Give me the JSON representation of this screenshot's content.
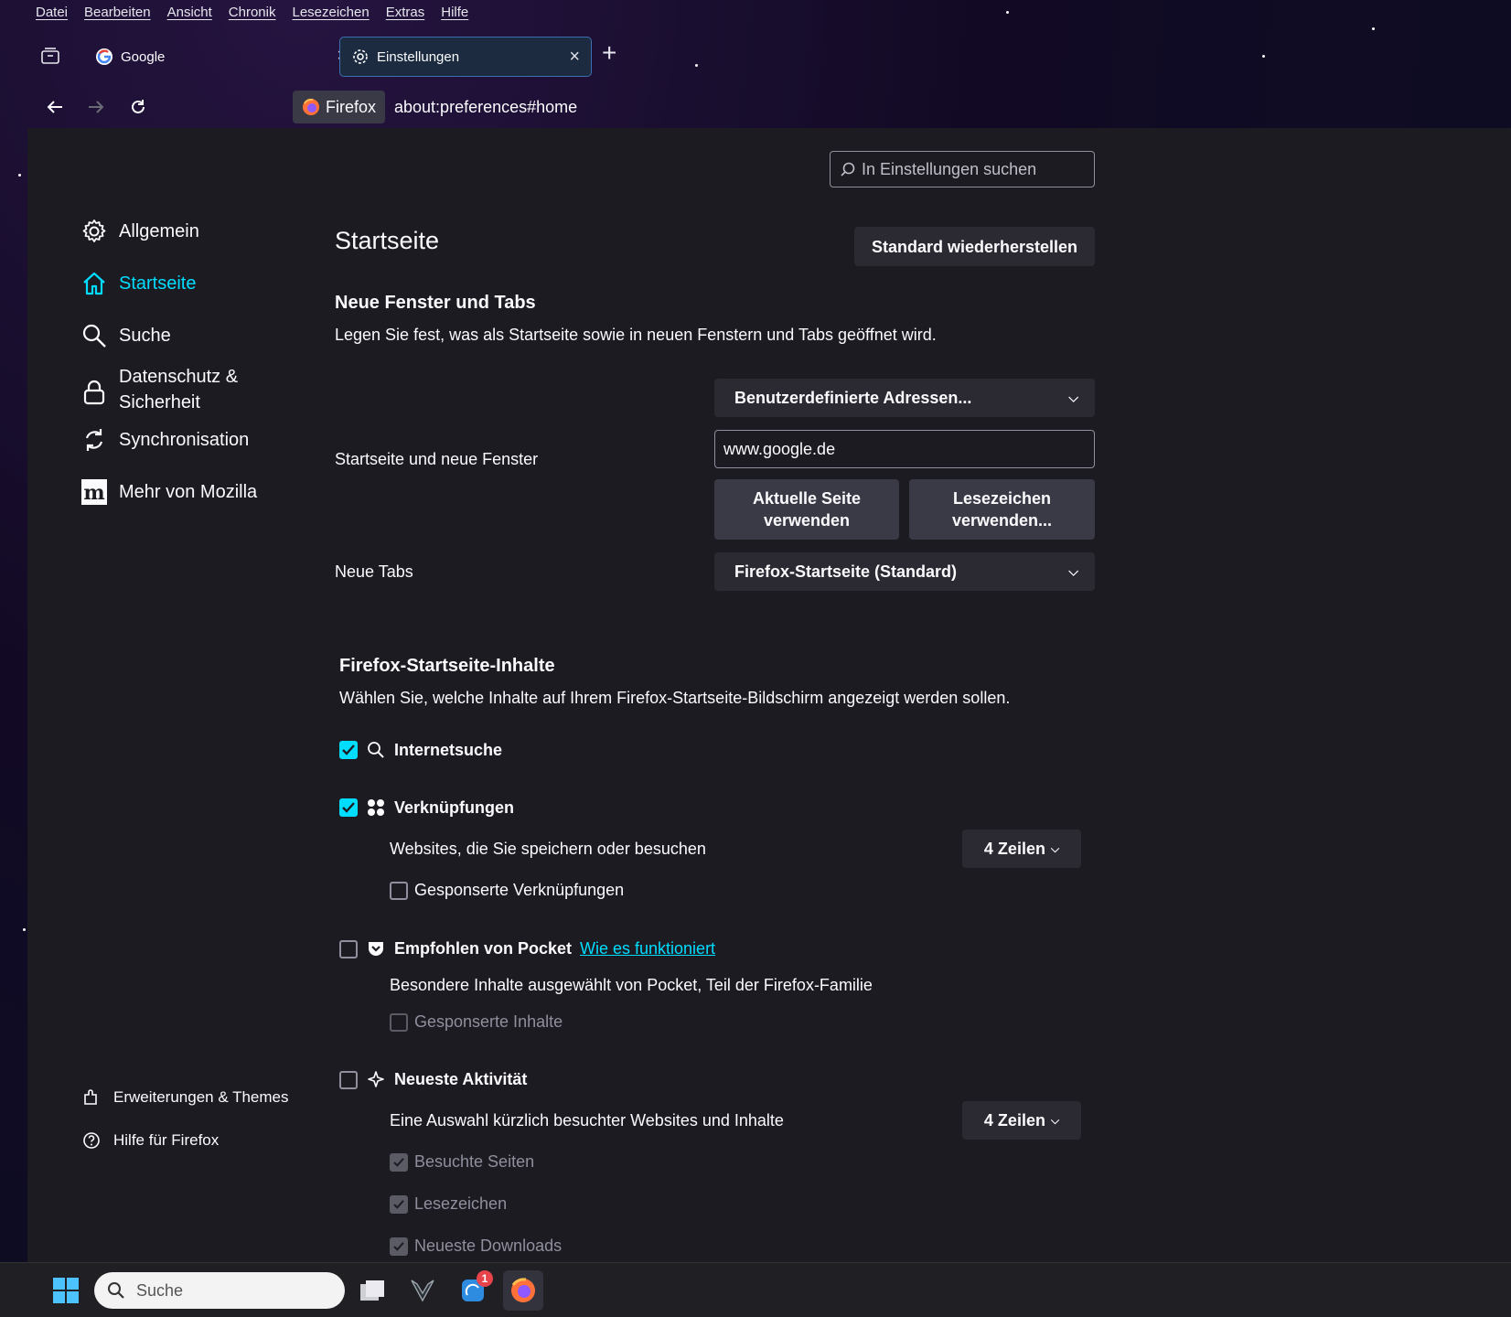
{
  "menubar": [
    "Datei",
    "Bearbeiten",
    "Ansicht",
    "Chronik",
    "Lesezeichen",
    "Extras",
    "Hilfe"
  ],
  "tabs": [
    {
      "label": "Google",
      "icon": "google-icon"
    },
    {
      "label": "Einstellungen",
      "icon": "gear-icon"
    }
  ],
  "urlbar": {
    "identity": "Firefox",
    "url": "about:preferences#home"
  },
  "search": {
    "placeholder": "In Einstellungen suchen"
  },
  "sidebar": {
    "items": [
      {
        "label": "Allgemein",
        "icon": "gear-icon"
      },
      {
        "label": "Startseite",
        "icon": "home-icon",
        "selected": true
      },
      {
        "label": "Suche",
        "icon": "search-icon"
      },
      {
        "label": "Datenschutz &",
        "label2": "Sicherheit",
        "icon": "lock-icon"
      },
      {
        "label": "Synchronisation",
        "icon": "sync-icon"
      },
      {
        "label": "Mehr von Mozilla",
        "icon": "mozilla-icon"
      }
    ],
    "footer": [
      {
        "label": "Erweiterungen & Themes",
        "icon": "puzzle-icon"
      },
      {
        "label": "Hilfe für Firefox",
        "icon": "help-icon"
      }
    ]
  },
  "main": {
    "title": "Startseite",
    "restore_button": "Standard wiederherstellen",
    "section1": {
      "heading": "Neue Fenster und Tabs",
      "description": "Legen Sie fest, was als Startseite sowie in neuen Fenstern und Tabs geöffnet wird.",
      "homepage_label": "Startseite und neue Fenster",
      "homepage_select": "Benutzerdefinierte Adressen...",
      "homepage_url": "www.google.de",
      "use_current_line1": "Aktuelle Seite",
      "use_current_line2": "verwenden",
      "use_bookmark_line1": "Lesezeichen",
      "use_bookmark_line2": "verwenden...",
      "newtabs_label": "Neue Tabs",
      "newtabs_select": "Firefox-Startseite (Standard)"
    },
    "section2": {
      "heading": "Firefox-Startseite-Inhalte",
      "description": "Wählen Sie, welche Inhalte auf Ihrem Firefox-Startseite-Bildschirm angezeigt werden sollen.",
      "websearch": {
        "label": "Internetsuche",
        "checked": true
      },
      "shortcuts": {
        "label": "Verknüpfungen",
        "checked": true,
        "description": "Websites, die Sie speichern oder besuchen",
        "rows": "4 Zeilen",
        "sponsored": "Gesponserte Verknüpfungen"
      },
      "pocket": {
        "label": "Empfohlen von Pocket",
        "link": "Wie es funktioniert",
        "description": "Besondere Inhalte ausgewählt von Pocket, Teil der Firefox-Familie",
        "sponsored": "Gesponserte Inhalte"
      },
      "highlights": {
        "label": "Neueste Aktivität",
        "description": "Eine Auswahl kürzlich besuchter Websites und Inhalte",
        "rows": "4 Zeilen",
        "visited": "Besuchte Seiten",
        "bookmarks": "Lesezeichen",
        "downloads": "Neueste Downloads"
      }
    }
  },
  "taskbar": {
    "search": "Suche",
    "badge": "1"
  },
  "colors": {
    "accent": "#00ddff",
    "background": "#1c1b22",
    "button": "#2b2a33"
  }
}
